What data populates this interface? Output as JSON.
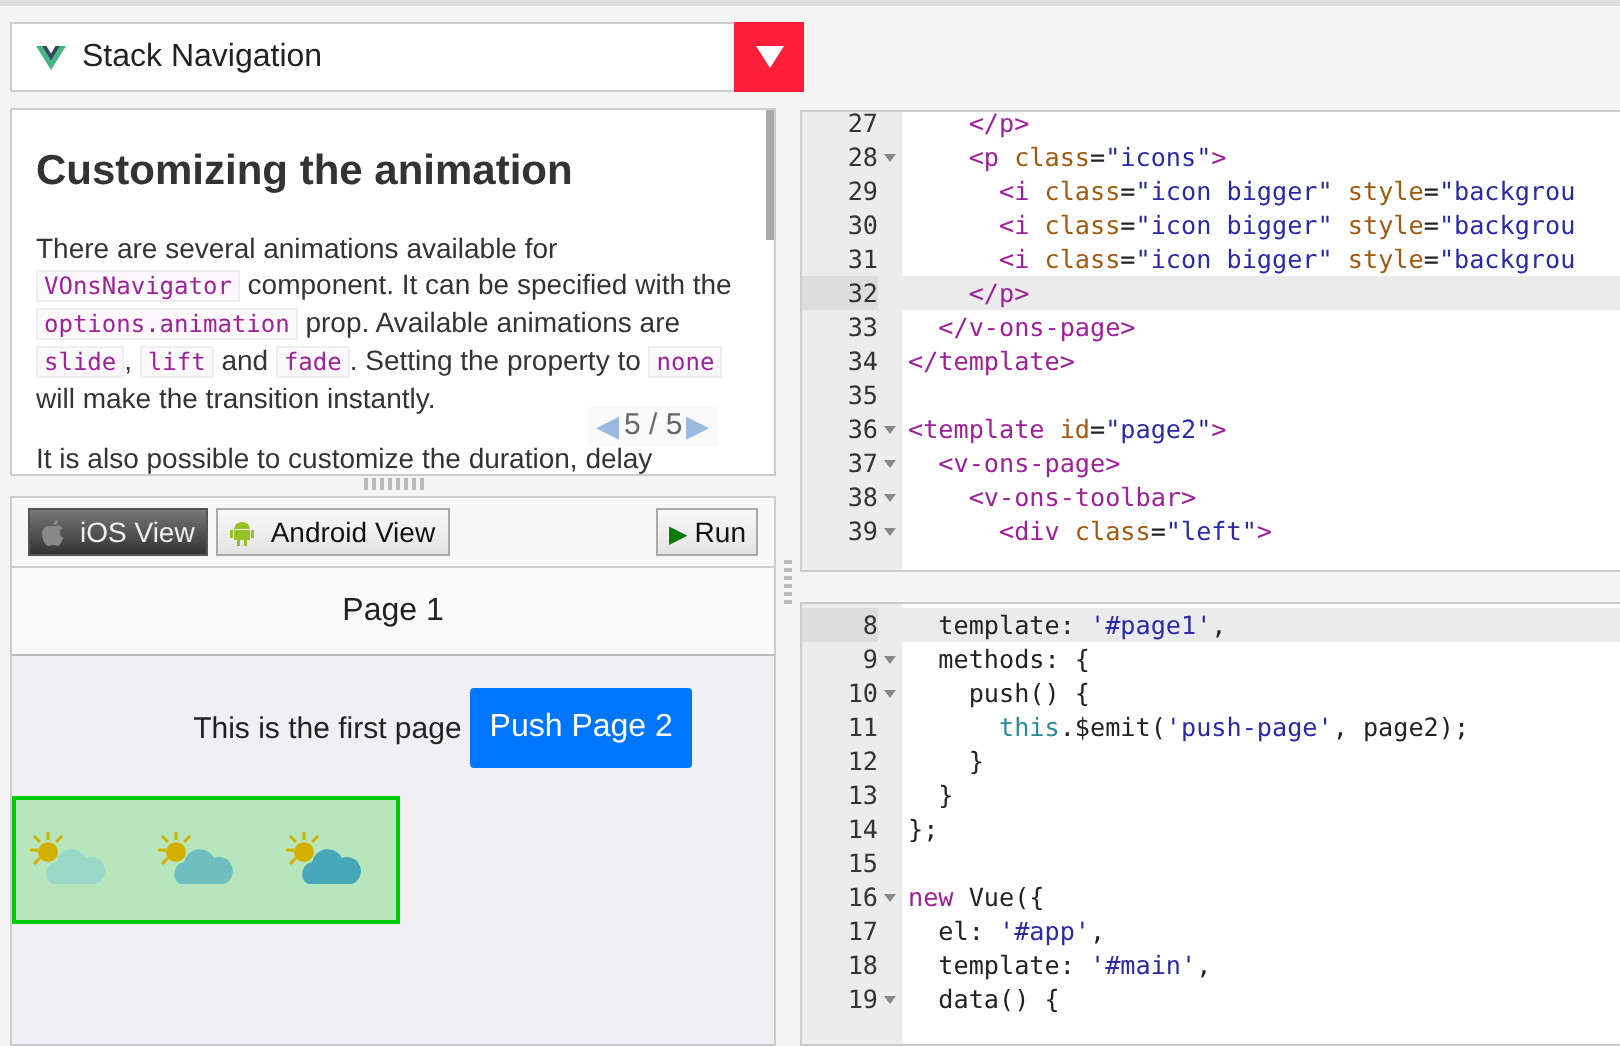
{
  "selector": {
    "title": "Stack Navigation"
  },
  "doc": {
    "heading": "Customizing the animation",
    "paragraphs": [
      [
        {
          "text": "There are several animations available for ",
          "kind": "text"
        },
        {
          "text": "VOnsNavigator",
          "kind": "code"
        },
        {
          "text": " component. It can be specified with the ",
          "kind": "text"
        },
        {
          "text": "options.animation",
          "kind": "code"
        },
        {
          "text": " prop. Available animations are ",
          "kind": "text"
        },
        {
          "text": "slide",
          "kind": "code"
        },
        {
          "text": ", ",
          "kind": "text"
        },
        {
          "text": "lift",
          "kind": "code"
        },
        {
          "text": " and ",
          "kind": "text"
        },
        {
          "text": "fade",
          "kind": "code"
        },
        {
          "text": ". Setting the property to ",
          "kind": "text"
        },
        {
          "text": "none",
          "kind": "code"
        },
        {
          "text": " will make the transition instantly.",
          "kind": "text"
        }
      ],
      [
        {
          "text": "It is also possible to customize the duration, delay",
          "kind": "text"
        }
      ]
    ],
    "pager": {
      "prev": "◀",
      "label": "5 / 5",
      "next": "▶"
    }
  },
  "preview_toolbar": {
    "views": [
      {
        "label": "iOS View",
        "kind": "apple",
        "selected": true
      },
      {
        "label": "Android View",
        "kind": "android",
        "selected": false
      }
    ],
    "run": {
      "icon": "▶",
      "label": "Run"
    }
  },
  "preview": {
    "toolbar_title": "Page 1",
    "text": "This is the first page",
    "button": "Push Page 2",
    "icons": [
      {
        "color": "#9ad9c8"
      },
      {
        "color": "#6fbfc0"
      },
      {
        "color": "#45a7b8"
      }
    ]
  },
  "editors": [
    {
      "lines": [
        {
          "num": "27",
          "fold": false,
          "active": false,
          "tokens": [
            {
              "t": "    </p>",
              "kind": "tag"
            }
          ]
        },
        {
          "num": "28",
          "fold": true,
          "active": false,
          "tokens": [
            {
              "t": "    <p",
              "kind": "tag"
            },
            {
              "t": " class",
              "kind": "attr"
            },
            {
              "t": "=",
              "kind": "plain"
            },
            {
              "t": "\"icons\"",
              "kind": "string"
            },
            {
              "t": ">",
              "kind": "tag"
            }
          ]
        },
        {
          "num": "29",
          "fold": false,
          "active": false,
          "tokens": [
            {
              "t": "      <i",
              "kind": "tag"
            },
            {
              "t": " class",
              "kind": "attr"
            },
            {
              "t": "=",
              "kind": "plain"
            },
            {
              "t": "\"icon bigger\"",
              "kind": "string"
            },
            {
              "t": " style",
              "kind": "attr"
            },
            {
              "t": "=",
              "kind": "plain"
            },
            {
              "t": "\"backgrou",
              "kind": "string"
            }
          ]
        },
        {
          "num": "30",
          "fold": false,
          "active": false,
          "tokens": [
            {
              "t": "      <i",
              "kind": "tag"
            },
            {
              "t": " class",
              "kind": "attr"
            },
            {
              "t": "=",
              "kind": "plain"
            },
            {
              "t": "\"icon bigger\"",
              "kind": "string"
            },
            {
              "t": " style",
              "kind": "attr"
            },
            {
              "t": "=",
              "kind": "plain"
            },
            {
              "t": "\"backgrou",
              "kind": "string"
            }
          ]
        },
        {
          "num": "31",
          "fold": false,
          "active": false,
          "tokens": [
            {
              "t": "      <i",
              "kind": "tag"
            },
            {
              "t": " class",
              "kind": "attr"
            },
            {
              "t": "=",
              "kind": "plain"
            },
            {
              "t": "\"icon bigger\"",
              "kind": "string"
            },
            {
              "t": " style",
              "kind": "attr"
            },
            {
              "t": "=",
              "kind": "plain"
            },
            {
              "t": "\"backgrou",
              "kind": "string"
            }
          ]
        },
        {
          "num": "32",
          "fold": false,
          "active": true,
          "tokens": [
            {
              "t": "    </p>",
              "kind": "tag"
            }
          ]
        },
        {
          "num": "33",
          "fold": false,
          "active": false,
          "tokens": [
            {
              "t": "  </v-ons-page>",
              "kind": "tag"
            }
          ]
        },
        {
          "num": "34",
          "fold": false,
          "active": false,
          "tokens": [
            {
              "t": "</template>",
              "kind": "tag"
            }
          ]
        },
        {
          "num": "35",
          "fold": false,
          "active": false
        },
        {
          "num": "36",
          "fold": true,
          "active": false,
          "tokens": [
            {
              "t": "<template",
              "kind": "tag"
            },
            {
              "t": " id",
              "kind": "attr"
            },
            {
              "t": "=",
              "kind": "plain"
            },
            {
              "t": "\"page2\"",
              "kind": "string"
            },
            {
              "t": ">",
              "kind": "tag"
            }
          ]
        },
        {
          "num": "37",
          "fold": true,
          "active": false,
          "tokens": [
            {
              "t": "  <v-ons-page>",
              "kind": "tag"
            }
          ]
        },
        {
          "num": "38",
          "fold": true,
          "active": false,
          "tokens": [
            {
              "t": "    <v-ons-toolbar>",
              "kind": "tag"
            }
          ]
        },
        {
          "num": "39",
          "fold": true,
          "active": false,
          "tokens": [
            {
              "t": "      <div",
              "kind": "tag"
            },
            {
              "t": " class",
              "kind": "attr"
            },
            {
              "t": "=",
              "kind": "plain"
            },
            {
              "t": "\"left\"",
              "kind": "string"
            },
            {
              "t": ">",
              "kind": "tag"
            }
          ]
        }
      ]
    },
    {
      "lines": [
        {
          "num": "8",
          "fold": false,
          "active": true,
          "tokens": [
            {
              "t": "  template: ",
              "kind": "plain"
            },
            {
              "t": "'#page1'",
              "kind": "string"
            },
            {
              "t": ",",
              "kind": "plain"
            }
          ]
        },
        {
          "num": "9",
          "fold": true,
          "active": false,
          "tokens": [
            {
              "t": "  methods: {",
              "kind": "plain"
            }
          ]
        },
        {
          "num": "10",
          "fold": true,
          "active": false,
          "tokens": [
            {
              "t": "    push() {",
              "kind": "plain"
            }
          ]
        },
        {
          "num": "11",
          "fold": false,
          "active": false,
          "tokens": [
            {
              "t": "      this",
              "kind": "var"
            },
            {
              "t": ".$emit(",
              "kind": "plain"
            },
            {
              "t": "'push-page'",
              "kind": "string"
            },
            {
              "t": ", page2);",
              "kind": "plain"
            }
          ]
        },
        {
          "num": "12",
          "fold": false,
          "active": false,
          "tokens": [
            {
              "t": "    }",
              "kind": "plain"
            }
          ]
        },
        {
          "num": "13",
          "fold": false,
          "active": false,
          "tokens": [
            {
              "t": "  }",
              "kind": "plain"
            }
          ]
        },
        {
          "num": "14",
          "fold": false,
          "active": false,
          "tokens": [
            {
              "t": "};",
              "kind": "plain"
            }
          ]
        },
        {
          "num": "15",
          "fold": false,
          "active": false
        },
        {
          "num": "16",
          "fold": true,
          "active": false,
          "tokens": [
            {
              "t": "new",
              "kind": "keyword"
            },
            {
              "t": " Vue({",
              "kind": "plain"
            }
          ]
        },
        {
          "num": "17",
          "fold": false,
          "active": false,
          "tokens": [
            {
              "t": "  el: ",
              "kind": "plain"
            },
            {
              "t": "'#app'",
              "kind": "string"
            },
            {
              "t": ",",
              "kind": "plain"
            }
          ]
        },
        {
          "num": "18",
          "fold": false,
          "active": false,
          "tokens": [
            {
              "t": "  template: ",
              "kind": "plain"
            },
            {
              "t": "'#main'",
              "kind": "string"
            },
            {
              "t": ",",
              "kind": "plain"
            }
          ]
        },
        {
          "num": "19",
          "fold": true,
          "active": false,
          "tokens": [
            {
              "t": "  data() {",
              "kind": "plain"
            }
          ]
        }
      ]
    }
  ]
}
